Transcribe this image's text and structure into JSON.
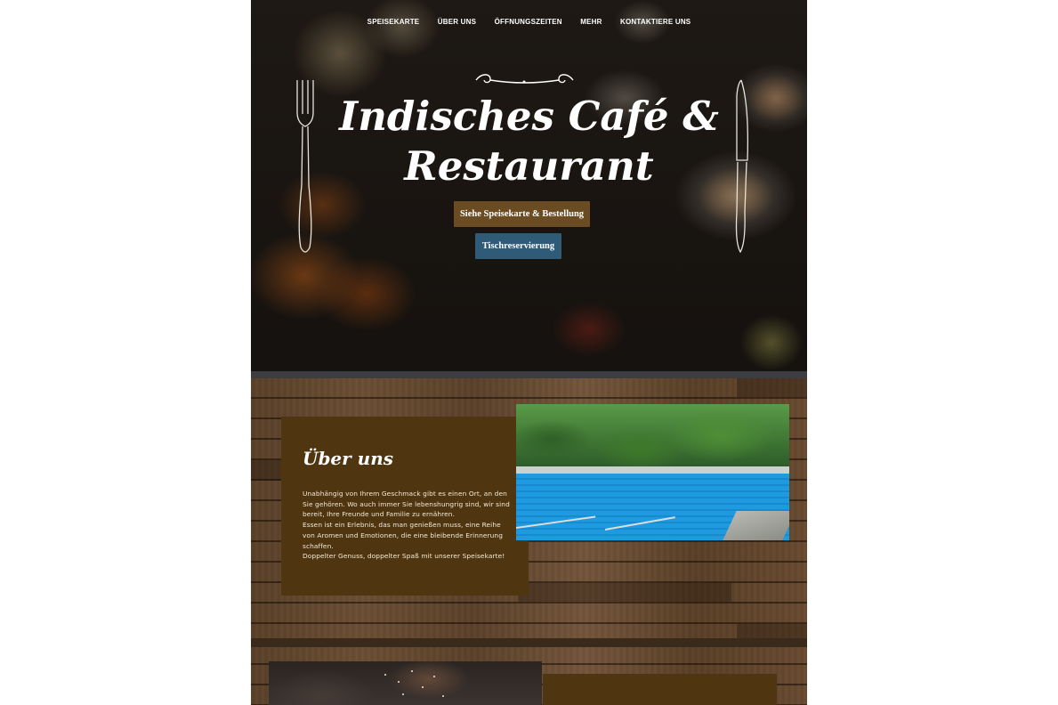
{
  "nav": {
    "items": [
      "SPEISEKARTE",
      "ÜBER UNS",
      "ÖFFNUNGSZEITEN",
      "MEHR",
      "KONTAKTIERE UNS"
    ]
  },
  "hero": {
    "title_line1": "Indisches Café &",
    "title_line2": "Restaurant",
    "menu_button": "Siehe Speisekarte & Bestellung",
    "reserve_button": "Tischreservierung"
  },
  "about": {
    "title": "Über uns",
    "paragraphs": [
      "Unabhängig von Ihrem Geschmack gibt es einen Ort, an den Sie gehören. Wo auch immer Sie lebenshungrig sind, wir sind bereit, Ihre Freunde und Familie zu ernähren.",
      "Essen ist ein Erlebnis, das man genießen muss, eine Reihe von Aromen und Emotionen, die eine bleibende Erinnerung schaffen.",
      "Doppelter Genuss, doppelter Spaß mit unserer Speisekarte!"
    ]
  },
  "colors": {
    "menu_button": "#6b4c22",
    "reserve_button": "#2f5a78",
    "about_box": "#4f3610"
  },
  "icons": [
    "ornament-icon",
    "fork-icon",
    "knife-icon"
  ]
}
